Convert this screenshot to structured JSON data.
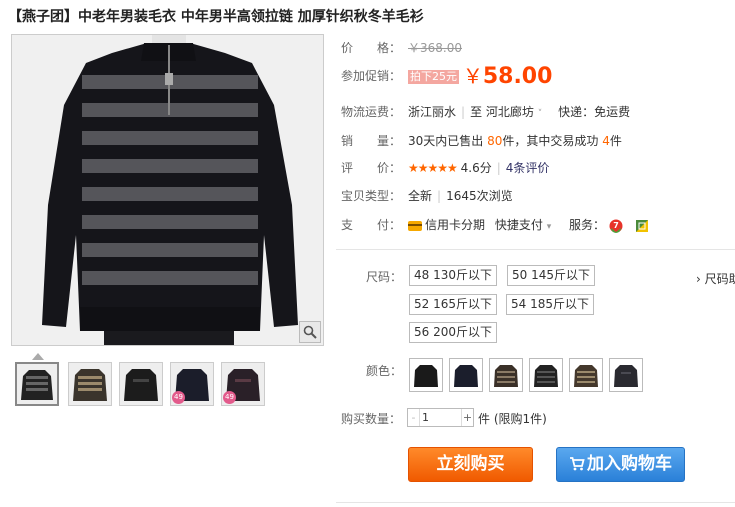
{
  "product": {
    "title": "【燕子团】中老年男装毛衣 中年男半高领拉链 加厚针织秋冬羊毛衫"
  },
  "price": {
    "label": "价　　格：",
    "original": "￥368.00"
  },
  "promo": {
    "label": "参加促销：",
    "tag_text": "拍下25元",
    "currency": "￥",
    "price": "58.00"
  },
  "shipping": {
    "label": "物流运费：",
    "from": "浙江丽水",
    "to_word": "至",
    "to": "河北廊坊",
    "express": "快递：免运费"
  },
  "sales": {
    "label": "销　　量：",
    "prefix": "30天内已售出",
    "sold": "80",
    "middle": "件，其中交易成功",
    "success": "4",
    "suffix": "件"
  },
  "rating": {
    "label": "评　　价：",
    "stars": "★★★★★",
    "score": "4.6分",
    "reviews": "4条评价"
  },
  "condition": {
    "label": "宝贝类型：",
    "value": "全新",
    "views": "1645次浏览"
  },
  "payment": {
    "label": "支　　付：",
    "card": "信用卡分期",
    "quick": "快捷支付",
    "service_label": "服务："
  },
  "sizes": {
    "label": "尺码：",
    "options": [
      "48 130斤以下",
      "50 145斤以下",
      "52 165斤以下",
      "54 185斤以下",
      "56 200斤以下"
    ],
    "chart_link": "› 尺码助"
  },
  "colors": {
    "label": "颜色："
  },
  "quantity": {
    "label": "购买数量：",
    "value": "1",
    "minus": "-",
    "plus": "+",
    "note": "件 (限购1件)"
  },
  "thumbnails": {
    "badge": "49"
  },
  "actions": {
    "buy": "立刻购买",
    "cart": "加入购物车"
  },
  "colors_theme": {
    "accent": "#ff4400",
    "buy_button": "#f26a0e",
    "cart_button": "#3b8ee3"
  }
}
